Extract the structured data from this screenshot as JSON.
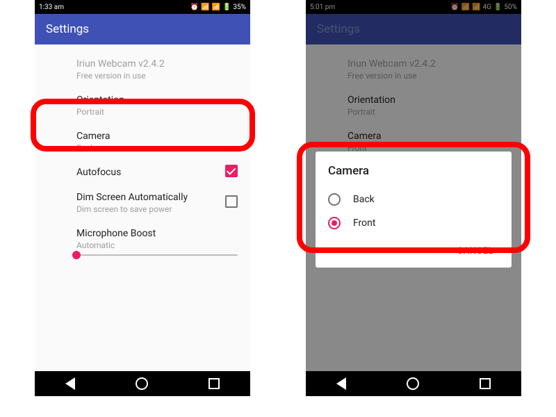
{
  "left": {
    "status": {
      "time": "1:33 am",
      "battery": "35%"
    },
    "appbar_title": "Settings",
    "info": {
      "title": "Iriun Webcam v2.4.2",
      "sub": "Free version in use"
    },
    "orientation": {
      "title": "Orientation",
      "sub": "Portrait"
    },
    "camera": {
      "title": "Camera",
      "sub": "Back"
    },
    "autofocus": {
      "title": "Autofocus"
    },
    "dim": {
      "title": "Dim Screen Automatically",
      "sub": "Dim screen to save power"
    },
    "mic": {
      "title": "Microphone Boost",
      "sub": "Automatic"
    }
  },
  "right": {
    "status": {
      "time": "5:01 pm",
      "battery": "50%",
      "net": "4G"
    },
    "appbar_title": "Settings",
    "info": {
      "title": "Iriun Webcam v2.4.2",
      "sub": "Free version in use"
    },
    "orientation": {
      "title": "Orientation",
      "sub": "Portrait"
    },
    "camera": {
      "title": "Camera",
      "sub": "Front"
    },
    "dialog": {
      "title": "Camera",
      "options": [
        {
          "label": "Back",
          "selected": false
        },
        {
          "label": "Front",
          "selected": true
        }
      ],
      "cancel": "CANCEL"
    }
  }
}
